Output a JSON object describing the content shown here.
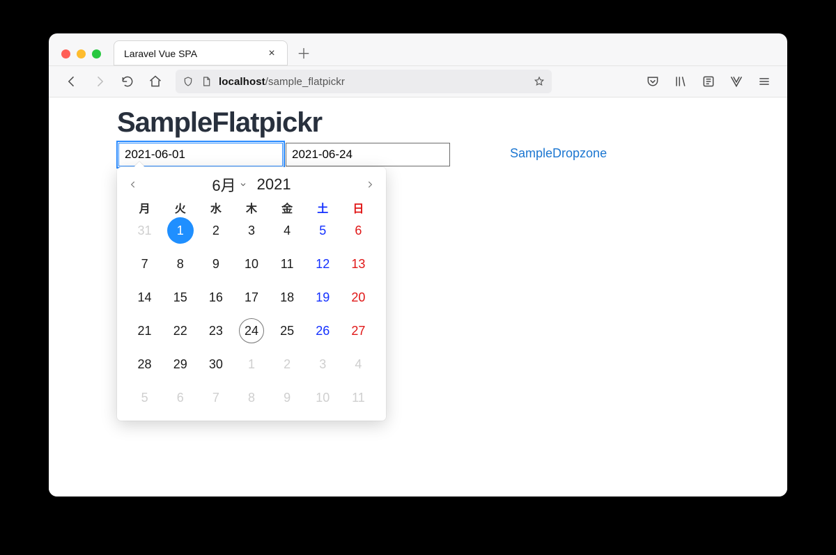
{
  "browser": {
    "tab_title": "Laravel Vue SPA",
    "url_host": "localhost",
    "url_path": "/sample_flatpickr",
    "icons": {
      "close": "close-icon",
      "new_tab": "plus-icon",
      "back": "back-icon",
      "forward": "forward-icon",
      "reload": "reload-icon",
      "home": "home-icon",
      "shield": "shield-icon",
      "page": "page-icon",
      "star": "star-icon",
      "pocket": "pocket-icon",
      "library": "library-icon",
      "reader": "reader-icon",
      "vue": "vue-icon",
      "menu": "hamburger-icon"
    }
  },
  "page": {
    "title": "SampleFlatpickr",
    "date1": "2021-06-01",
    "date2": "2021-06-24",
    "link_label": "SampleDropzone"
  },
  "calendar": {
    "month_label": "6月",
    "year": "2021",
    "weekdays": [
      "月",
      "火",
      "水",
      "木",
      "金",
      "土",
      "日"
    ],
    "selected_day": 1,
    "today": 24,
    "prev_tail": [
      31
    ],
    "days_in_month": 30,
    "next_head": [
      1,
      2,
      3,
      4,
      5,
      6,
      7,
      8,
      9,
      10,
      11
    ]
  }
}
